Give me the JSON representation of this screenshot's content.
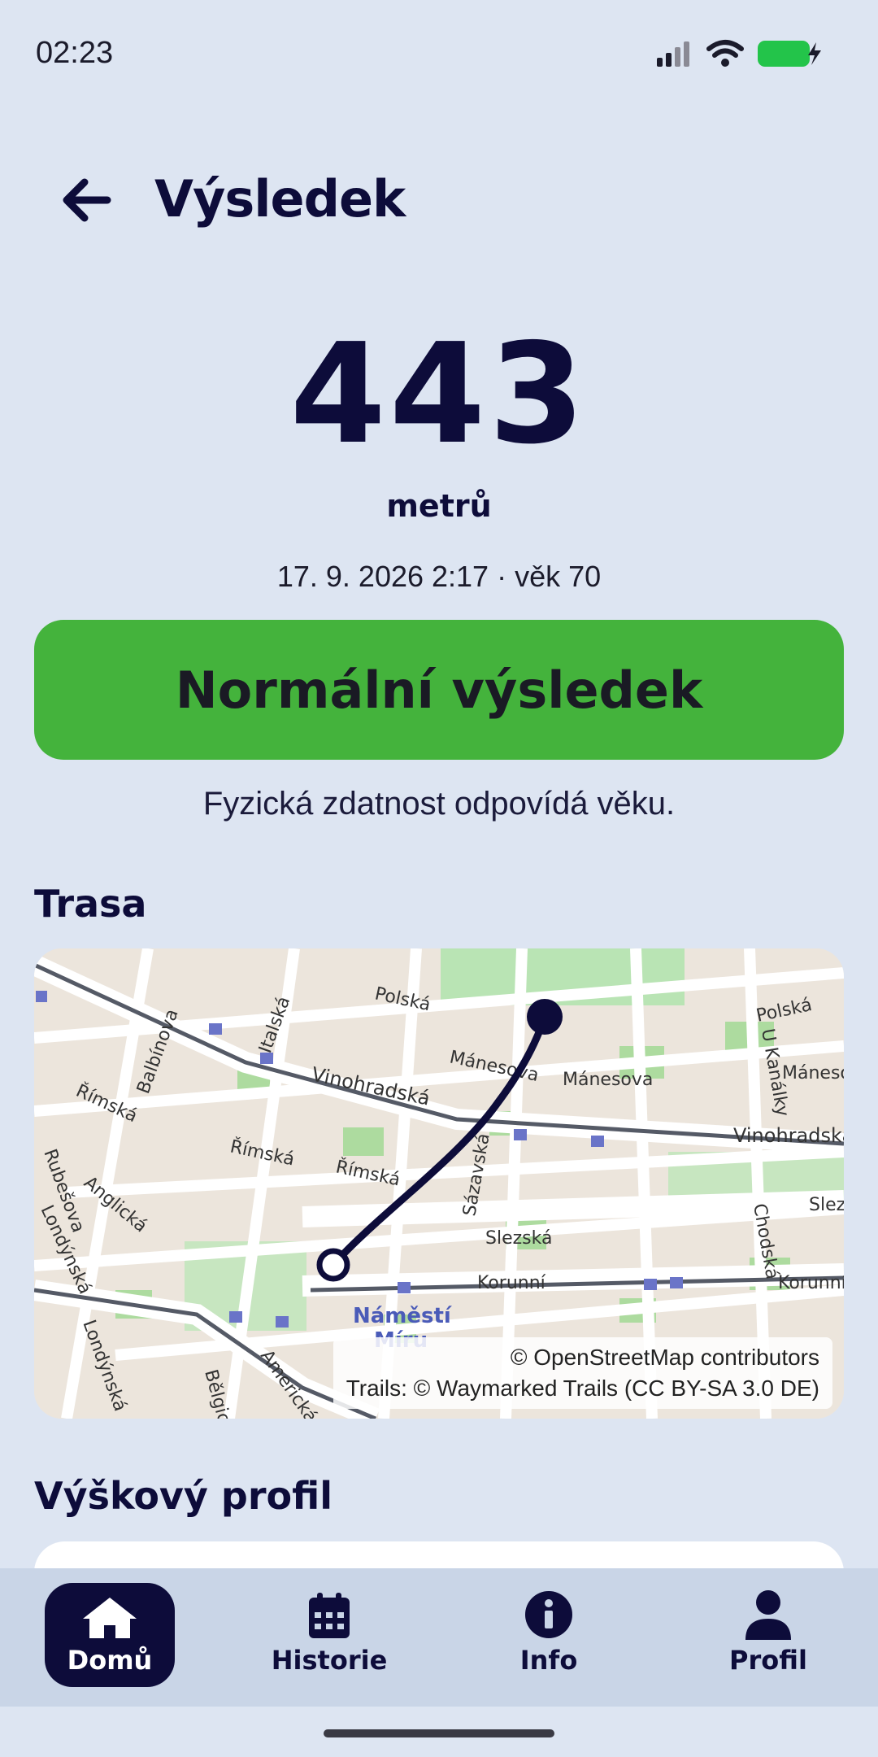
{
  "status": {
    "time": "02:23"
  },
  "header": {
    "title": "Výsledek"
  },
  "result": {
    "distance": "443",
    "unit": "metrů",
    "meta": "17. 9. 2026 2:17 · věk 70",
    "verdict": "Normální výsledek",
    "description": "Fyzická zdatnost odpovídá věku.",
    "verdict_color": "#44b33c"
  },
  "route": {
    "section_title": "Trasa",
    "streets": [
      "Polská",
      "Polská",
      "Italská",
      "Balbínova",
      "Římská",
      "Rubešova",
      "Mánesova",
      "Mánesova",
      "Mánesova",
      "Vinohradská",
      "Vinohradská",
      "Římská",
      "Římská",
      "Anglická",
      "Londýnská",
      "Londýnská",
      "Sázavská",
      "Slezská",
      "Slezská",
      "Korunní",
      "Korunní",
      "Chodská",
      "U Kanálky",
      "Americká",
      "Bělgic",
      "Náměstí",
      "Míru"
    ],
    "attribution_1": "© OpenStreetMap contributors",
    "attribution_2": "Trails: © Waymarked Trails (CC BY-SA 3.0 DE)"
  },
  "elevation": {
    "section_title": "Výškový profil"
  },
  "nav": {
    "items": [
      {
        "label": "Domů",
        "icon": "home-icon",
        "active": true
      },
      {
        "label": "Historie",
        "icon": "calendar-icon",
        "active": false
      },
      {
        "label": "Info",
        "icon": "info-icon",
        "active": false
      },
      {
        "label": "Profil",
        "icon": "person-icon",
        "active": false
      }
    ]
  }
}
